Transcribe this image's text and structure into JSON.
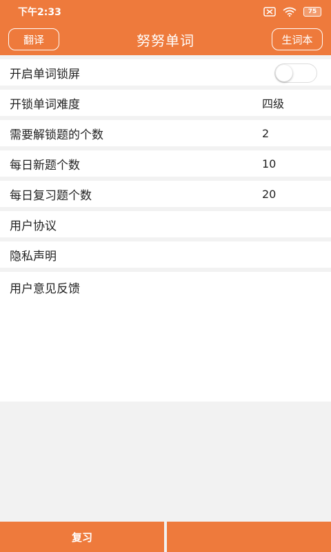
{
  "status_bar": {
    "time": "下午2:33",
    "battery": "75"
  },
  "header": {
    "title": "努努单词",
    "left_button": "翻译",
    "right_button": "生词本"
  },
  "settings": {
    "lock_screen": {
      "label": "开启单词锁屏",
      "enabled": false
    },
    "difficulty": {
      "label": "开锁单词难度",
      "value": "四级"
    },
    "unlock_count": {
      "label": "需要解锁题的个数",
      "value": "2"
    },
    "daily_new": {
      "label": "每日新题个数",
      "value": "10"
    },
    "daily_review": {
      "label": "每日复习题个数",
      "value": "20"
    },
    "user_agreement": {
      "label": "用户协议"
    },
    "privacy": {
      "label": "隐私声明"
    },
    "feedback": {
      "label": "用户意见反馈"
    }
  },
  "bottom_bar": {
    "review": "复习",
    "second": ""
  },
  "colors": {
    "accent": "#ee7a3c",
    "background": "#f2f2f2"
  }
}
